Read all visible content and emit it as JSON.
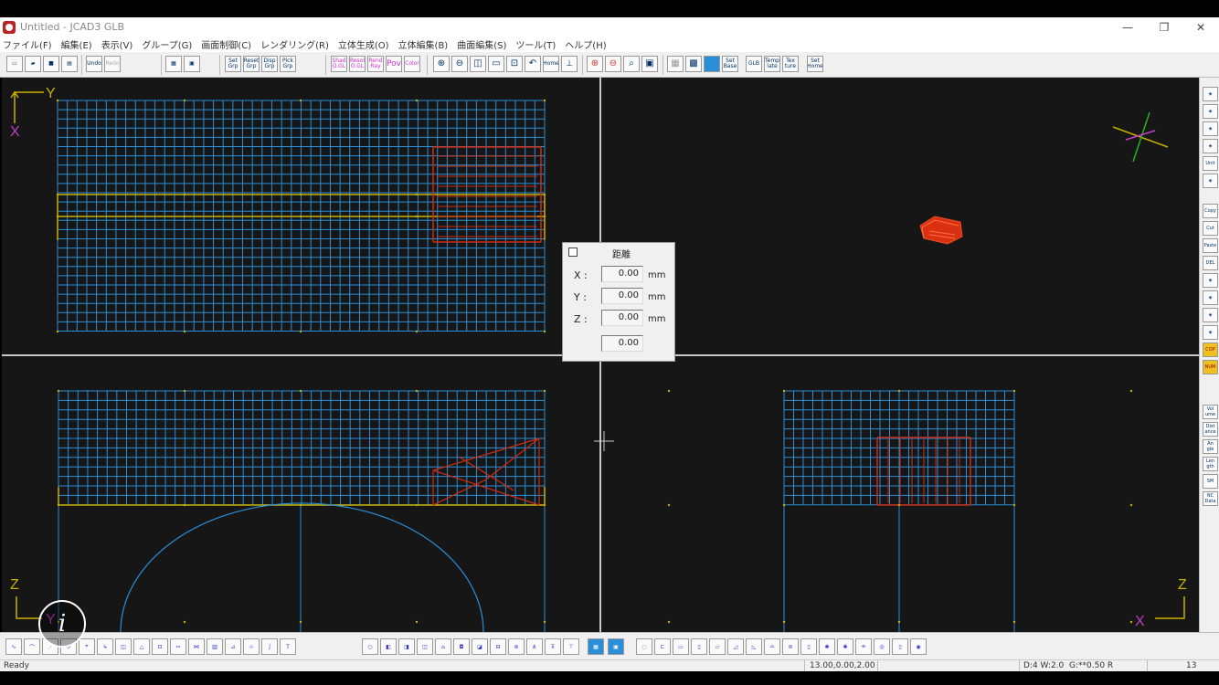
{
  "window": {
    "title": "Untitled - JCAD3 GLB",
    "minimize": "—",
    "restore": "❐",
    "close": "✕"
  },
  "menu": [
    "ファイル(F)",
    "編集(E)",
    "表示(V)",
    "グループ(G)",
    "画面制御(C)",
    "レンダリング(R)",
    "立体生成(O)",
    "立体編集(B)",
    "曲面編集(S)",
    "ツール(T)",
    "ヘルプ(H)"
  ],
  "toolbar": {
    "set_grp": "Set Grp",
    "reset_grp": "Reset Grp",
    "disp_grp": "Disp Grp",
    "pick_grp": "Pick Grp",
    "shad_ogl": "Shad O.GL",
    "resol_ogl": "Resol O.GL",
    "rend_ray": "Rend Ray",
    "pov": "Pov",
    "color": "Color",
    "home": "Home",
    "set_base": "Set Base",
    "glb": "GLB",
    "temp_late": "Temp late",
    "tex_ture": "Tex ture",
    "set_home": "Set Home",
    "undo": "Undo",
    "redo": "Redo"
  },
  "axes": {
    "top_left_y": "Y",
    "top_left_x": "X",
    "bottom_left_z": "Z",
    "bottom_left_y": "Y",
    "bottom_right_z": "Z",
    "bottom_right_x": "X"
  },
  "distance_dialog": {
    "title": "距離",
    "x_label": "X :",
    "x_value": "0.00",
    "y_label": "Y :",
    "y_value": "0.00",
    "z_label": "Z :",
    "z_value": "0.00",
    "unit": "mm",
    "total_value": "0.00"
  },
  "rightbar": [
    "",
    "",
    "",
    "",
    "Unit",
    "",
    "Copy",
    "Cut",
    "Paste",
    "DEL",
    "",
    "",
    "",
    "",
    "COP",
    "NUM",
    "Vol ume",
    "Dist ance",
    "An gle",
    "Len gth",
    "SM",
    "NC Data"
  ],
  "statusbar": {
    "ready": "Ready",
    "coords": "13.00,0.00,2.00",
    "display": "D:4 W:2.0",
    "grid": "G:**0.50 R",
    "page": "13"
  },
  "colors": {
    "background": "#161616",
    "grid": "#2a8fd8",
    "object": "#d02a10",
    "highlight": "#c8b000",
    "divider": "#c8c8c8"
  }
}
